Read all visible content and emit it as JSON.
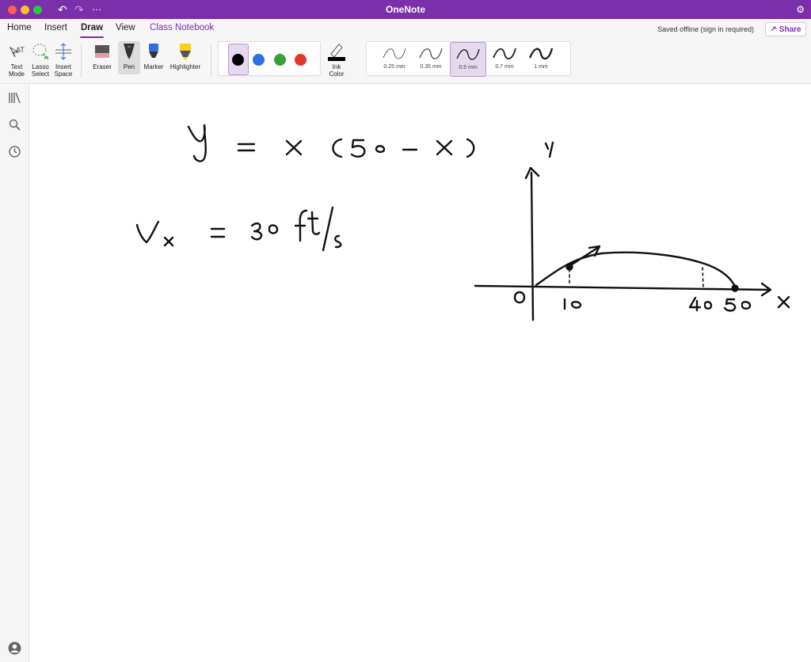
{
  "app": {
    "title": "OneNote"
  },
  "tabs": [
    "Home",
    "Insert",
    "Draw",
    "View",
    "Class Notebook"
  ],
  "status": "Saved offline (sign in required)",
  "share_label": "Share",
  "tools": {
    "text_mode": [
      "Text",
      "Mode"
    ],
    "lasso": [
      "Lasso",
      "Select"
    ],
    "insert_space": [
      "Insert",
      "Space"
    ],
    "eraser": "Eraser",
    "pen": "Pen",
    "marker": "Marker",
    "highlighter": "Highlighter",
    "ink_color": [
      "Ink",
      "Color"
    ]
  },
  "colors": {
    "black": "#000000",
    "blue": "#2f6fe4",
    "green": "#3a9e3a",
    "red": "#e0392b",
    "accent": "#7b2fa8"
  },
  "thickness": [
    "0.25 mm",
    "0.35 mm",
    "0.5 mm",
    "0.7 mm",
    "1 mm"
  ],
  "selected_thickness": "0.5 mm",
  "nav_icons": [
    "notebooks-icon",
    "search-icon",
    "recent-icon",
    "account-icon"
  ]
}
